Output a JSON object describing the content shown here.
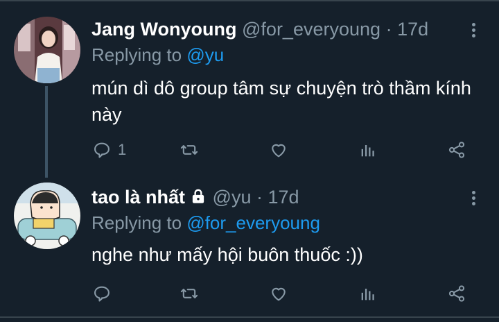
{
  "tweets": [
    {
      "name": "Jang Wonyoung",
      "handle": "@for_everyoung",
      "separator": "·",
      "time": "17d",
      "replying_prefix": "Replying to",
      "replying_to": "@yu",
      "text": "mún dì dô group tâm sự chuyện trò thầm kính này",
      "reply_count": "1",
      "retweet_count": "",
      "like_count": "",
      "locked": false
    },
    {
      "name": "tao là nhất",
      "handle": "@yu",
      "separator": "·",
      "time": "17d",
      "replying_prefix": "Replying to",
      "replying_to": "@for_everyoung",
      "text": "nghe như mấy hội buôn thuốc :))",
      "reply_count": "",
      "retweet_count": "",
      "like_count": "",
      "locked": true
    }
  ],
  "icons": {
    "reply": "reply-icon",
    "retweet": "retweet-icon",
    "like": "heart-icon",
    "analytics": "analytics-icon",
    "share": "share-icon",
    "more": "more-vertical-icon",
    "lock": "lock-icon"
  },
  "colors": {
    "background": "#15202b",
    "text": "#ffffff",
    "muted": "#8899a6",
    "link": "#1d9bf0",
    "thread_line": "#3d5466"
  }
}
